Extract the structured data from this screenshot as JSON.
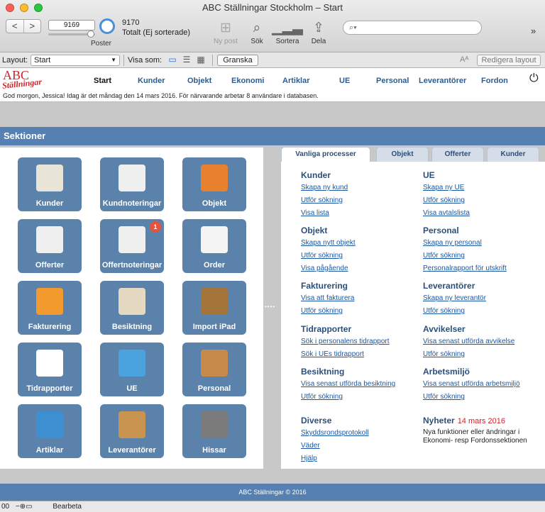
{
  "window": {
    "title": "ABC Ställningar Stockholm – Start"
  },
  "toolbar": {
    "back": "<",
    "forward": ">",
    "record": "9169",
    "poster_label": "Poster",
    "total_count": "9170",
    "total_label": "Totalt (Ej sorterade)",
    "new_record": "Ny post",
    "search": "Sök",
    "sort": "Sortera",
    "share": "Dela",
    "search_placeholder": "",
    "more": "»"
  },
  "layoutbar": {
    "layout_label": "Layout:",
    "layout_value": "Start",
    "view_label": "Visa som:",
    "review": "Granska",
    "aa": "Aᴬ",
    "edit_layout": "Redigera layout"
  },
  "logo": {
    "line1": "ABC",
    "line2": "Ställningar"
  },
  "nav": [
    "Start",
    "Kunder",
    "Objekt",
    "Ekonomi",
    "Artiklar",
    "UE",
    "Personal",
    "Leverantörer",
    "Fordon"
  ],
  "greeting": "God morgon, Jessica! Idag är det måndag den 14 mars 2016. För närvarande arbetar 8 användare i databasen.",
  "section_title": "Sektioner",
  "tiles": [
    {
      "label": "Kunder",
      "icon": "contact-card-icon",
      "color": "#e9e4d8"
    },
    {
      "label": "Kundnoteringar",
      "icon": "pinned-note-icon",
      "color": "#efefef"
    },
    {
      "label": "Objekt",
      "icon": "house-icon",
      "color": "#e8812f"
    },
    {
      "label": "Offerter",
      "icon": "document-icon",
      "color": "#efefef"
    },
    {
      "label": "Offertnoteringar",
      "icon": "pinned-note-icon",
      "color": "#efefef",
      "badge": "1"
    },
    {
      "label": "Order",
      "icon": "envelope-icon",
      "color": "#f4f4f4"
    },
    {
      "label": "Fakturering",
      "icon": "calculator-icon",
      "color": "#f29a2e"
    },
    {
      "label": "Besiktning",
      "icon": "clipboard-icon",
      "color": "#e6d9c2"
    },
    {
      "label": "Import iPad",
      "icon": "box-import-icon",
      "color": "#a3753a"
    },
    {
      "label": "Tidrapporter",
      "icon": "clock-icon",
      "color": "#ffffff"
    },
    {
      "label": "UE",
      "icon": "group-icon",
      "color": "#4aa3df"
    },
    {
      "label": "Personal",
      "icon": "people-icon",
      "color": "#c78a4b"
    },
    {
      "label": "Artiklar",
      "icon": "tools-icon",
      "color": "#3e8fd1"
    },
    {
      "label": "Leverantörer",
      "icon": "package-icon",
      "color": "#c99450"
    },
    {
      "label": "Hissar",
      "icon": "scissor-lift-icon",
      "color": "#7a7a7a"
    }
  ],
  "tabs": [
    "Vanliga processer",
    "Objekt",
    "Offerter",
    "Kunder"
  ],
  "sections": {
    "kunder": {
      "title": "Kunder",
      "links": [
        "Skapa ny kund",
        "Utför sökning",
        "Visa lista"
      ]
    },
    "ue": {
      "title": "UE",
      "links": [
        "Skapa ny UE",
        "Utför sökning",
        "Visa avtalslista"
      ]
    },
    "objekt": {
      "title": "Objekt",
      "links": [
        "Skapa nytt objekt",
        "Utför sökning",
        "Visa pågående"
      ]
    },
    "personal": {
      "title": "Personal",
      "links": [
        "Skapa ny personal",
        "Utför sökning",
        "Personalrapport för utskrift"
      ]
    },
    "fakturering": {
      "title": "Fakturering",
      "links": [
        "Visa att fakturera",
        "Utför sökning"
      ]
    },
    "leverantorer": {
      "title": "Leverantörer",
      "links": [
        "Skapa ny leverantör",
        "Utför sökning"
      ]
    },
    "tidrapporter": {
      "title": "Tidrapporter",
      "links": [
        "Sök i personalens tidrapport",
        "Sök i UEs tidrapport"
      ]
    },
    "avvikelser": {
      "title": "Avvikelser",
      "links": [
        "Visa senast utförda avvikelse",
        "Utför sökning"
      ]
    },
    "besiktning": {
      "title": "Besiktning",
      "links": [
        "Visa senast utförda besiktning",
        "Utför sökning"
      ]
    },
    "arbetsmiljo": {
      "title": "Arbetsmiljö",
      "links": [
        "Visa senast utförda arbetsmiljö",
        "Utför sökning"
      ]
    },
    "diverse": {
      "title": "Diverse",
      "links": [
        "Skyddsrondsprotokoll",
        "Väder",
        "Hjälp"
      ]
    }
  },
  "news": {
    "title": "Nyheter",
    "date": "14 mars 2016",
    "text": "Nya funktioner eller ändringar i Ekonomi- resp Fordonssektionen"
  },
  "footer": "ABC Ställningar © 2016",
  "status": {
    "zoom": "00",
    "mode": "Bearbeta"
  }
}
